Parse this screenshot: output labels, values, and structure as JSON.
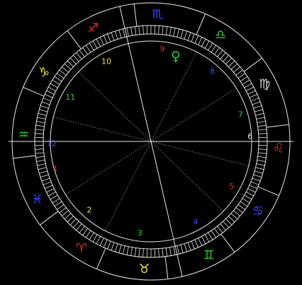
{
  "zodiac_signs": [
    {
      "name": "sagittarius",
      "glyph": "♐",
      "color": "#e0302a"
    },
    {
      "name": "scorpio",
      "glyph": "♏",
      "color": "#3a4cff"
    },
    {
      "name": "libra",
      "glyph": "♎",
      "color": "#2fd02f"
    },
    {
      "name": "virgo",
      "glyph": "♍",
      "color": "#d8d8d8"
    },
    {
      "name": "leo",
      "glyph": "♌",
      "color": "#e0302a"
    },
    {
      "name": "cancer",
      "glyph": "♋",
      "color": "#3a4cff"
    },
    {
      "name": "gemini",
      "glyph": "♊",
      "color": "#2fd02f"
    },
    {
      "name": "taurus",
      "glyph": "♉",
      "color": "#e8e840"
    },
    {
      "name": "aries",
      "glyph": "♈",
      "color": "#e0302a"
    },
    {
      "name": "pisces",
      "glyph": "♓",
      "color": "#3a4cff"
    },
    {
      "name": "aquarius",
      "glyph": "♒",
      "color": "#2fd02f"
    },
    {
      "name": "capricorn",
      "glyph": "♑",
      "color": "#e8e840"
    }
  ],
  "houses": [
    {
      "label": "1",
      "color": "#e0302a"
    },
    {
      "label": "2",
      "color": "#e8e840"
    },
    {
      "label": "3",
      "color": "#2fd02f"
    },
    {
      "label": "4",
      "color": "#3a4cff"
    },
    {
      "label": "5",
      "color": "#e0302a"
    },
    {
      "label": "6",
      "color": "#e8e8e8"
    },
    {
      "label": "7",
      "color": "#2fd02f"
    },
    {
      "label": "8",
      "color": "#3a4cff"
    },
    {
      "label": "9",
      "color": "#e0302a"
    },
    {
      "label": "10",
      "color": "#e8e840"
    },
    {
      "label": "11",
      "color": "#2fd02f"
    },
    {
      "label": "12",
      "color": "#3a4cff"
    }
  ],
  "planets": [
    {
      "name": "venus",
      "glyph": "♀",
      "color": "#2fd02f"
    }
  ],
  "colors": {
    "background": "#000000",
    "lines": "#e8e8e8",
    "dotted": "#9a9a9a"
  }
}
